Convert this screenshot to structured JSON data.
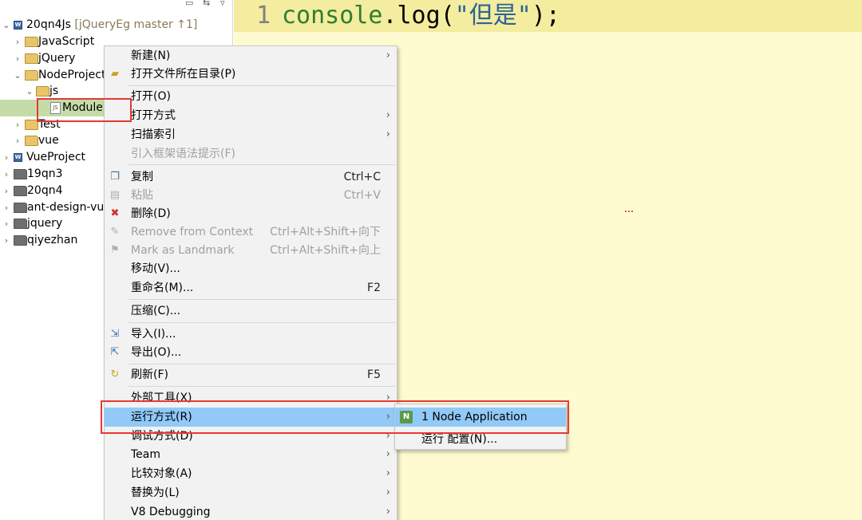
{
  "explorer": {
    "items": [
      {
        "label": "20qn4Js",
        "branch": " [jQueryEg master ↑1]",
        "icon": "project-icon"
      },
      {
        "label": "JavaScript",
        "icon": "folder-icon"
      },
      {
        "label": "jQuery",
        "icon": "folder-icon"
      },
      {
        "label": "NodeProject",
        "icon": "folder-icon"
      },
      {
        "label": "js",
        "icon": "folder-icon"
      },
      {
        "label": "Module",
        "icon": "js-file-icon"
      },
      {
        "label": "Test",
        "icon": "folder-icon"
      },
      {
        "label": "vue",
        "icon": "folder-icon"
      },
      {
        "label": "VueProject",
        "icon": "project-icon"
      },
      {
        "label": "19qn3",
        "icon": "folder-icon"
      },
      {
        "label": "20qn4",
        "icon": "folder-icon"
      },
      {
        "label": "ant-design-vue",
        "icon": "folder-icon"
      },
      {
        "label": "jquery",
        "icon": "folder-icon"
      },
      {
        "label": "qiyezhan",
        "icon": "folder-icon"
      }
    ]
  },
  "editor": {
    "line_number": "1",
    "code": {
      "fn_obj": "console",
      "dot": ".",
      "fn_name": "log",
      "open": "(",
      "string": "\"但是\"",
      "close": ");"
    }
  },
  "context_menu": {
    "items": [
      {
        "label": "新建(N)",
        "has_submenu": true
      },
      {
        "label": "打开文件所在目录(P)",
        "icon": "folder-open-icon"
      },
      {
        "label": "打开(O)"
      },
      {
        "label": "打开方式",
        "has_submenu": true
      },
      {
        "label": "扫描索引",
        "has_submenu": true
      },
      {
        "label": "引入框架语法提示(F)",
        "disabled": true
      },
      {
        "label": "复制",
        "shortcut": "Ctrl+C",
        "icon": "copy-icon"
      },
      {
        "label": "粘贴",
        "shortcut": "Ctrl+V",
        "disabled": true,
        "icon": "paste-icon"
      },
      {
        "label": "删除(D)",
        "icon": "delete-icon"
      },
      {
        "label": "Remove from Context",
        "shortcut": "Ctrl+Alt+Shift+向下",
        "disabled": true,
        "icon": "remove-context-icon"
      },
      {
        "label": "Mark as Landmark",
        "shortcut": "Ctrl+Alt+Shift+向上",
        "disabled": true,
        "icon": "landmark-icon"
      },
      {
        "label": "移动(V)..."
      },
      {
        "label": "重命名(M)...",
        "shortcut": "F2"
      },
      {
        "label": "压缩(C)..."
      },
      {
        "label": "导入(I)...",
        "icon": "import-icon"
      },
      {
        "label": "导出(O)...",
        "icon": "export-icon"
      },
      {
        "label": "刷新(F)",
        "shortcut": "F5",
        "icon": "refresh-icon"
      },
      {
        "label": "外部工具(X)",
        "has_submenu": true
      },
      {
        "label": "运行方式(R)",
        "has_submenu": true,
        "highlighted": true
      },
      {
        "label": "调试方式(D)",
        "has_submenu": true
      },
      {
        "label": "Team",
        "has_submenu": true
      },
      {
        "label": "比较对象(A)",
        "has_submenu": true
      },
      {
        "label": "替换为(L)",
        "has_submenu": true
      },
      {
        "label": "V8 Debugging",
        "has_submenu": true
      }
    ]
  },
  "submenu": {
    "items": [
      {
        "label": "1 Node Application",
        "icon": "node-app-icon",
        "highlighted": true
      },
      {
        "label": "运行 配置(N)..."
      }
    ]
  },
  "colors": {
    "menu_highlight": "#91c9f7",
    "annotation_red": "#e53935",
    "editor_bg": "#fffbd0",
    "selected_row": "#c6dca8"
  }
}
